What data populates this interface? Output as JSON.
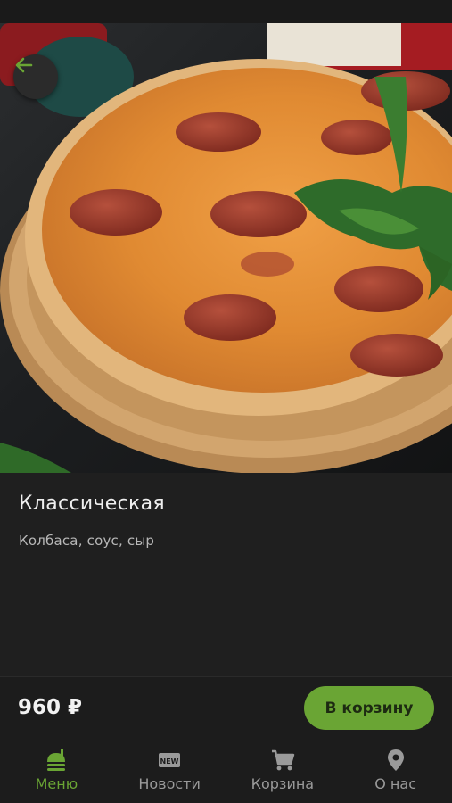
{
  "product": {
    "title": "Классическая",
    "description": "Колбаса, соус, сыр",
    "price": "960 ₽",
    "image_icon": "pizza-photo"
  },
  "actions": {
    "back_icon": "arrow-left-icon",
    "add_to_cart_label": "В корзину"
  },
  "tabbar": {
    "items": [
      {
        "label": "Меню",
        "icon": "menu-burger-icon",
        "active": true
      },
      {
        "label": "Новости",
        "icon": "new-badge-icon",
        "active": false
      },
      {
        "label": "Корзина",
        "icon": "cart-icon",
        "active": false
      },
      {
        "label": "О нас",
        "icon": "location-pin-icon",
        "active": false
      }
    ]
  },
  "colors": {
    "accent": "#6aa534",
    "background": "#1f1f1f",
    "text_primary": "#eeeeee",
    "text_secondary": "#b8b8b8",
    "inactive": "#9a9a9a"
  }
}
